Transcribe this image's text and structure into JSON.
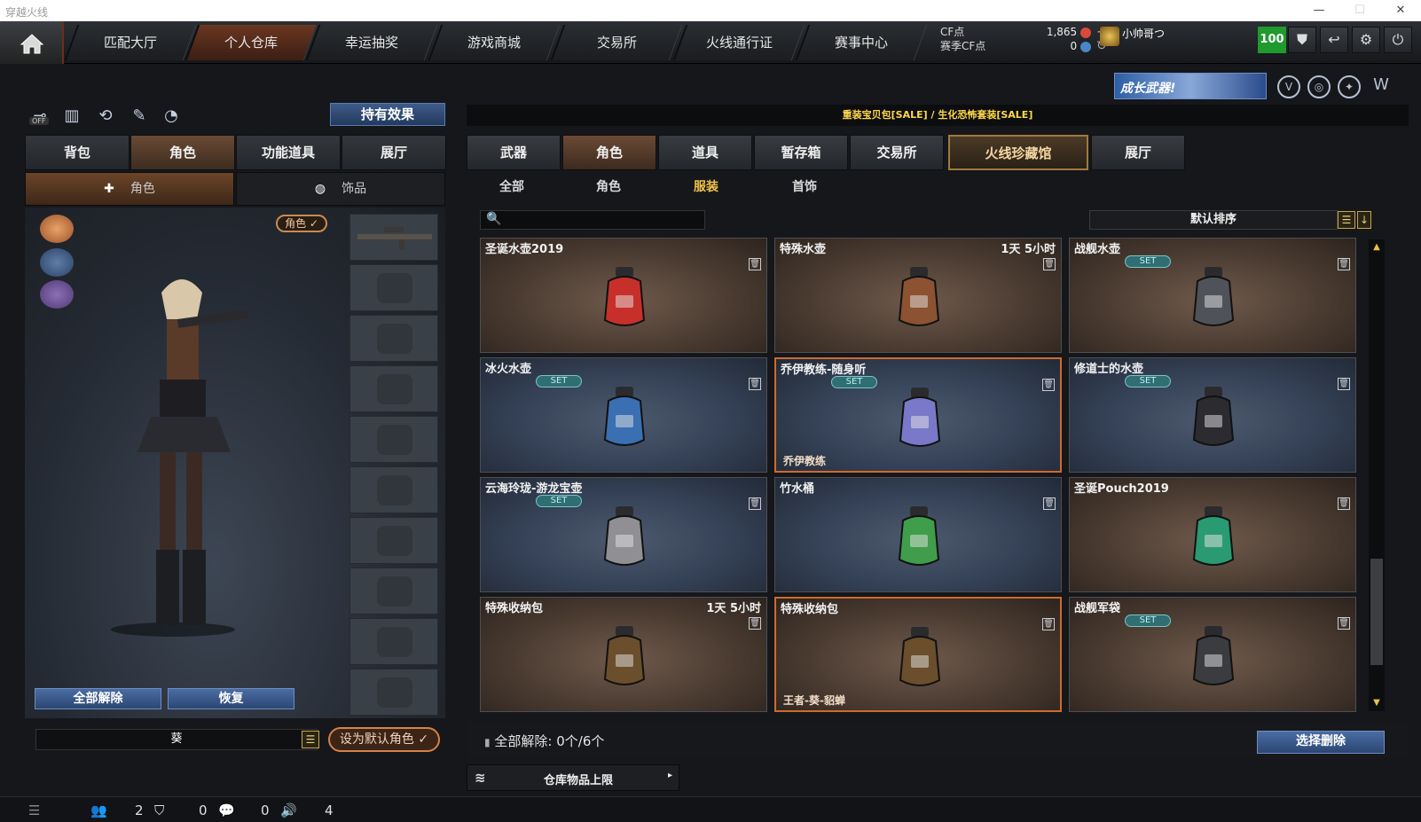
{
  "window": {
    "title": "穿越火线"
  },
  "nav": {
    "tabs": [
      {
        "label": "匹配大厅"
      },
      {
        "label": "个人仓库"
      },
      {
        "label": "幸运抽奖"
      },
      {
        "label": "游戏商城"
      },
      {
        "label": "交易所"
      },
      {
        "label": "火线通行证"
      },
      {
        "label": "赛事中心"
      }
    ],
    "cf_label": "CF点",
    "season_cf_label": "赛季CF点",
    "cf_value": "1,865",
    "season_cf_value": "0",
    "username": "小帅哥つ",
    "level": "100"
  },
  "promo": {
    "text": "成长武器!"
  },
  "left": {
    "holding_effect": "持有效果",
    "tabs": [
      "背包",
      "角色",
      "功能道具",
      "展厅"
    ],
    "subtabs": [
      "角色",
      "饰品"
    ],
    "off_label": "OFF",
    "role_tag": "角色 ✓",
    "unequip_all": "全部解除",
    "restore": "恢复",
    "char_name": "葵",
    "set_default": "设为默认角色"
  },
  "right": {
    "notice": "重装宝贝包[SALE] / 生化恐怖套装[SALE]",
    "tabs": [
      "武器",
      "角色",
      "道具",
      "暂存箱",
      "交易所",
      "火线珍藏馆",
      "展厅"
    ],
    "subtabs": [
      "全部",
      "角色",
      "服装",
      "首饰"
    ],
    "search_placeholder": "",
    "sort": "默认排序",
    "cards": [
      {
        "name": "圣诞水壶2019",
        "time": "",
        "set": "",
        "owner": ""
      },
      {
        "name": "特殊水壶",
        "time": "1天 5小时",
        "set": "",
        "owner": ""
      },
      {
        "name": "战舰水壶",
        "time": "",
        "set": "SET",
        "owner": ""
      },
      {
        "name": "冰火水壶",
        "time": "",
        "set": "SET",
        "owner": ""
      },
      {
        "name": "乔伊教练-随身听",
        "time": "",
        "set": "SET",
        "owner": "乔伊教练"
      },
      {
        "name": "修道士的水壶",
        "time": "",
        "set": "SET",
        "owner": ""
      },
      {
        "name": "云海玲珑-游龙宝壶",
        "time": "",
        "set": "SET",
        "owner": ""
      },
      {
        "name": "竹水桶",
        "time": "",
        "set": "",
        "owner": ""
      },
      {
        "name": "圣诞Pouch2019",
        "time": "",
        "set": "",
        "owner": ""
      },
      {
        "name": "特殊收纳包",
        "time": "1天 5小时",
        "set": "",
        "owner": ""
      },
      {
        "name": "特殊收纳包",
        "time": "",
        "set": "",
        "owner": "王者-葵-貂蝉"
      },
      {
        "name": "战舰军袋",
        "time": "",
        "set": "SET",
        "owner": ""
      }
    ],
    "unequip_label": "全部解除:",
    "unequip_count": "0个/6个",
    "select_delete": "选择删除",
    "storage_limit": "仓库物品上限"
  },
  "status": {
    "v1": "2",
    "v2": "0",
    "v3": "0",
    "v4": "4"
  },
  "colors": {
    "accent": "#cf6a2c",
    "gold": "#f2c24a",
    "blue_button": "#2b4672",
    "set_badge": "#2f6f74"
  }
}
